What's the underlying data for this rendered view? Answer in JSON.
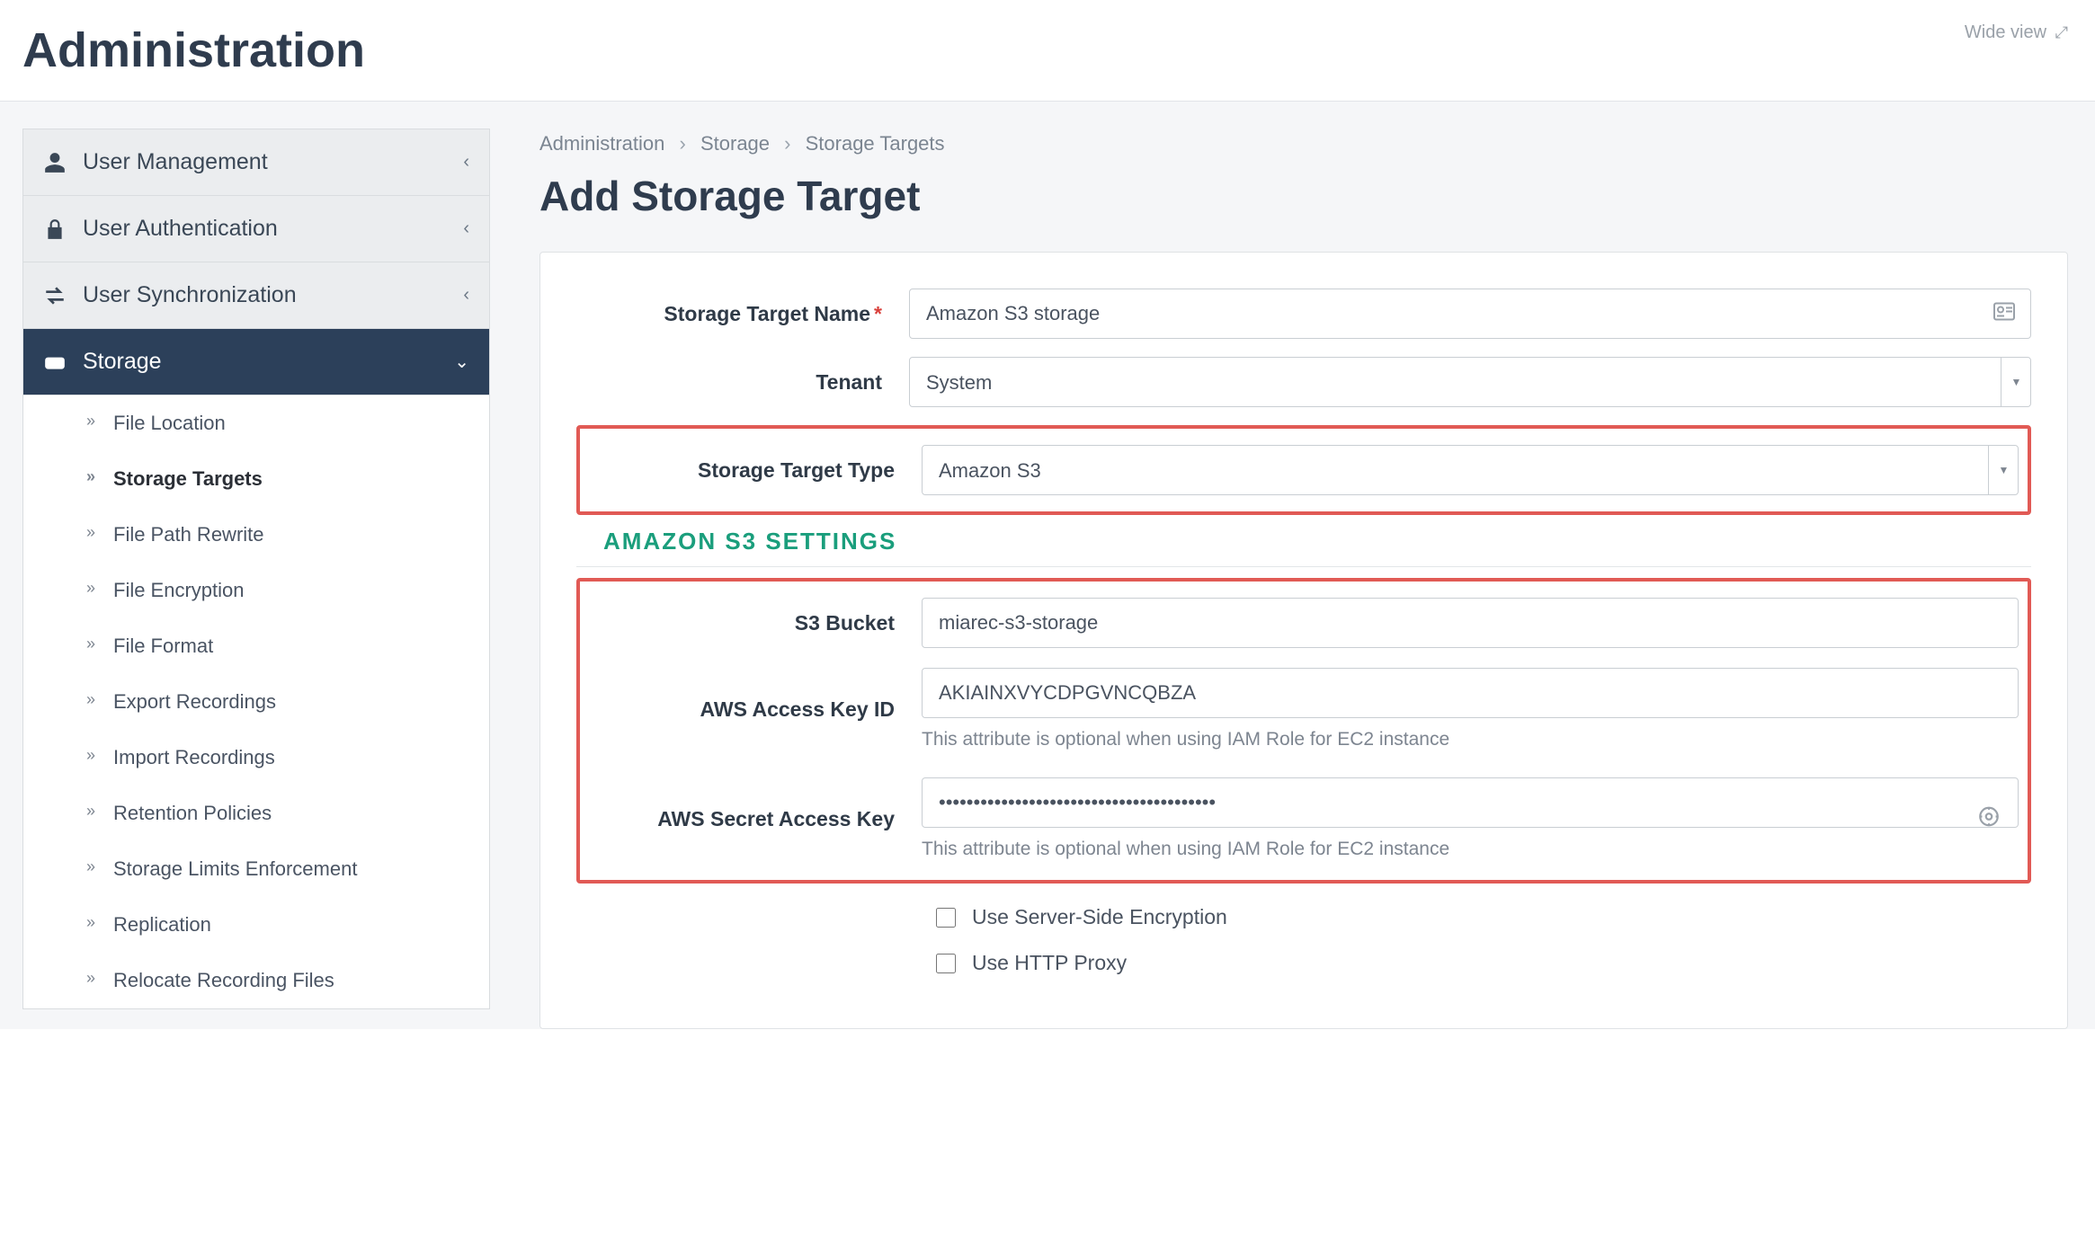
{
  "header": {
    "title": "Administration",
    "wide_view": "Wide view"
  },
  "sidebar": {
    "groups": [
      {
        "key": "user-management",
        "label": "User Management",
        "icon": "user-icon"
      },
      {
        "key": "user-authentication",
        "label": "User Authentication",
        "icon": "lock-icon"
      },
      {
        "key": "user-synchronization",
        "label": "User Synchronization",
        "icon": "sync-icon"
      },
      {
        "key": "storage",
        "label": "Storage",
        "icon": "disk-icon",
        "active": true
      }
    ],
    "storage_items": [
      "File Location",
      "Storage Targets",
      "File Path Rewrite",
      "File Encryption",
      "File Format",
      "Export Recordings",
      "Import Recordings",
      "Retention Policies",
      "Storage Limits Enforcement",
      "Replication",
      "Relocate Recording Files"
    ],
    "storage_active_index": 1
  },
  "breadcrumb": {
    "a": "Administration",
    "b": "Storage",
    "c": "Storage Targets"
  },
  "main": {
    "title": "Add Storage Target",
    "labels": {
      "name": "Storage Target Name",
      "tenant": "Tenant",
      "type": "Storage Target Type",
      "bucket": "S3 Bucket",
      "access": "AWS Access Key ID",
      "secret": "AWS Secret Access Key"
    },
    "values": {
      "name": "Amazon S3 storage",
      "tenant": "System",
      "type": "Amazon S3",
      "bucket": "miarec-s3-storage",
      "access": "AKIAINXVYCDPGVNCQBZA",
      "secret": "••••••••••••••••••••••••••••••••••••••••"
    },
    "section_title": "AMAZON  S3  SETTINGS",
    "hint": "This attribute is optional when using IAM Role for EC2 instance",
    "checks": {
      "sse": "Use Server-Side Encryption",
      "proxy": "Use HTTP Proxy"
    }
  }
}
